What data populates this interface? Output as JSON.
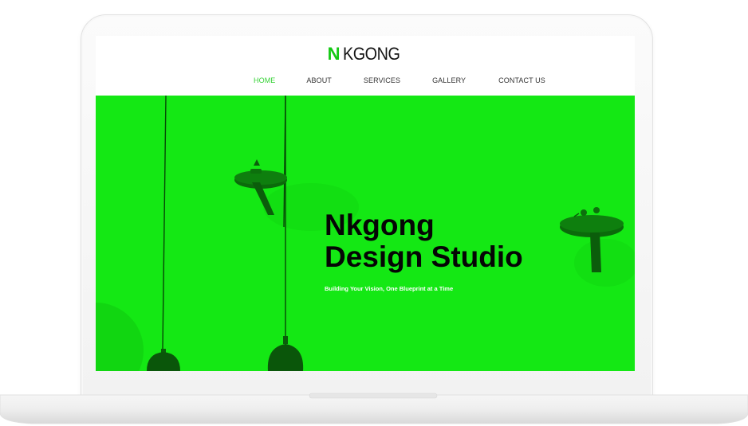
{
  "site": {
    "logo_first": "N",
    "logo_rest": "KGONG",
    "nav": [
      {
        "label": "HOME",
        "active": true
      },
      {
        "label": "ABOUT",
        "active": false
      },
      {
        "label": "SERVICES",
        "active": false
      },
      {
        "label": "GALLERY",
        "active": false
      },
      {
        "label": "CONTACT US",
        "active": false
      }
    ]
  },
  "hero": {
    "title_line1": "Nkgong",
    "title_line2": "Design Studio",
    "subtitle": "Building Your Vision, One Blueprint at a Time",
    "background_color": "#14e814",
    "image_icon": "pendant-lamps-image"
  },
  "colors": {
    "accent": "#14c914",
    "nav_active": "#35d235",
    "hero_green": "#14e814"
  }
}
